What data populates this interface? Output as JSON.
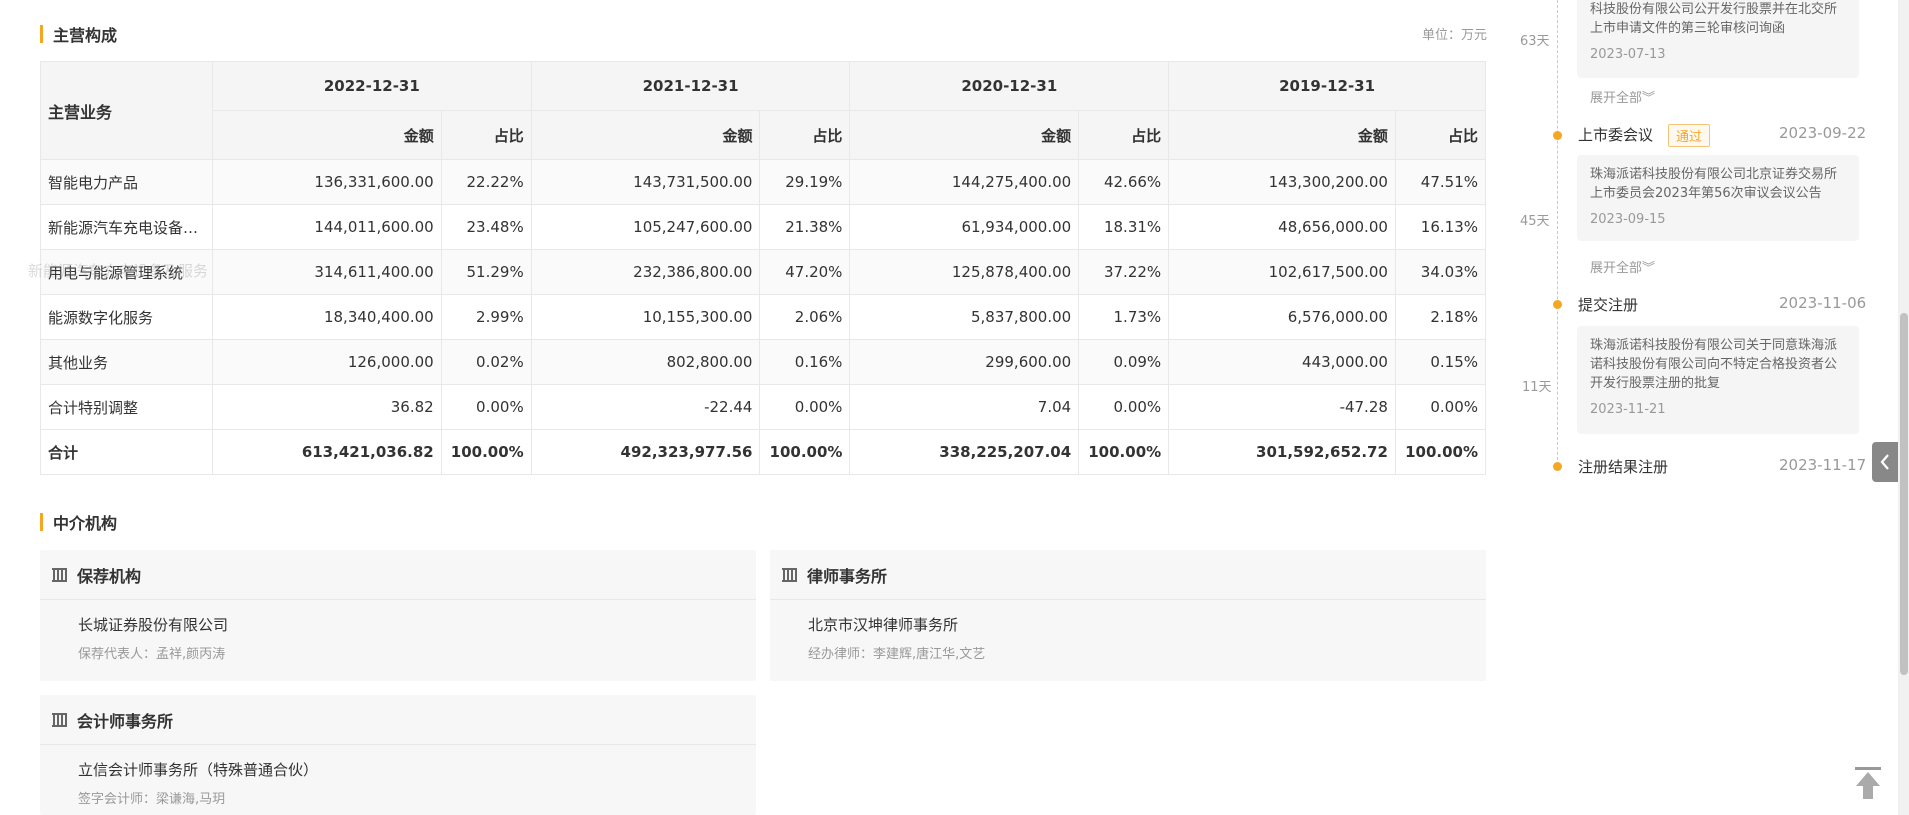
{
  "section_main": {
    "title": "主营构成",
    "unit": "单位：万元"
  },
  "table": {
    "biz_header": "主营业务",
    "years": [
      "2022-12-31",
      "2021-12-31",
      "2020-12-31",
      "2019-12-31"
    ],
    "col_amount": "金额",
    "col_ratio": "占比",
    "rows": [
      {
        "name": "智能电力产品",
        "cells": [
          "136,331,600.00",
          "22.22%",
          "143,731,500.00",
          "29.19%",
          "144,275,400.00",
          "42.66%",
          "143,300,200.00",
          "47.51%"
        ]
      },
      {
        "name": "新能源汽车充电设备…",
        "cells": [
          "144,011,600.00",
          "23.48%",
          "105,247,600.00",
          "21.38%",
          "61,934,000.00",
          "18.31%",
          "48,656,000.00",
          "16.13%"
        ]
      },
      {
        "name": "用电与能源管理系统",
        "cells": [
          "314,611,400.00",
          "51.29%",
          "232,386,800.00",
          "47.20%",
          "125,878,400.00",
          "37.22%",
          "102,617,500.00",
          "34.03%"
        ]
      },
      {
        "name": "能源数字化服务",
        "cells": [
          "18,340,400.00",
          "2.99%",
          "10,155,300.00",
          "2.06%",
          "5,837,800.00",
          "1.73%",
          "6,576,000.00",
          "2.18%"
        ]
      },
      {
        "name": "其他业务",
        "cells": [
          "126,000.00",
          "0.02%",
          "802,800.00",
          "0.16%",
          "299,600.00",
          "0.09%",
          "443,000.00",
          "0.15%"
        ]
      },
      {
        "name": "合计特别调整",
        "cells": [
          "36.82",
          "0.00%",
          "-22.44",
          "0.00%",
          "7.04",
          "0.00%",
          "-47.28",
          "0.00%"
        ]
      }
    ],
    "total": {
      "name": "合计",
      "cells": [
        "613,421,036.82",
        "100.00%",
        "492,323,977.56",
        "100.00%",
        "338,225,207.04",
        "100.00%",
        "301,592,652.72",
        "100.00%"
      ]
    }
  },
  "ghost_text": "新能源汽车充电设备及服务",
  "section_agency": {
    "title": "中介机构"
  },
  "agencies": {
    "sponsor": {
      "title": "保荐机构",
      "name": "长城证券股份有限公司",
      "sub": "保荐代表人：孟祥,颜丙涛"
    },
    "law": {
      "title": "律师事务所",
      "name": "北京市汉坤律师事务所",
      "sub": "经办律师：李建辉,唐江华,文艺"
    },
    "accounting": {
      "title": "会计师事务所",
      "name": "立信会计师事务所（特殊普通合伙）",
      "sub": "签字会计师：梁谦海,马玥"
    }
  },
  "timeline": {
    "top_box": {
      "text": "科技股份有限公司公开发行股票并在北交所上市申请文件的第三轮审核问询函",
      "date": "2023-07-13"
    },
    "expand_label": "展开全部",
    "days": [
      "63天",
      "45天",
      "11天"
    ],
    "events": [
      {
        "title": "上市委会议",
        "badge": "通过",
        "date": "2023-09-22",
        "box_text": "珠海派诺科技股份有限公司北京证券交易所上市委员会2023年第56次审议会议公告",
        "box_date": "2023-09-15"
      },
      {
        "title": "提交注册",
        "date": "2023-11-06",
        "box_text": "珠海派诺科技股份有限公司关于同意珠海派诺科技股份有限公司向不特定合格投资者公开发行股票注册的批复",
        "box_date": "2023-11-21"
      },
      {
        "title": "注册结果注册",
        "date": "2023-11-17"
      }
    ]
  },
  "colors": {
    "accent": "#f5a623",
    "text": "#333333",
    "muted": "#999999",
    "header_bg": "#f5f5f5"
  },
  "icons": {
    "side_tab": "chevron-left-icon",
    "back_to_top": "back-to-top-icon",
    "agency": "bank-icon"
  }
}
